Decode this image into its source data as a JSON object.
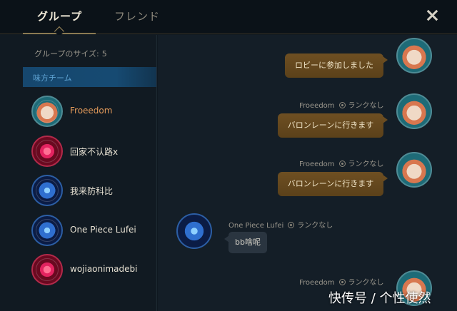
{
  "tabs": [
    {
      "label": "グループ",
      "active": true
    },
    {
      "label": "フレンド",
      "active": false
    }
  ],
  "group": {
    "size_label": "グループのサイズ:",
    "size_value": "5",
    "team_header": "味方チーム",
    "members": [
      {
        "name": "Froeedom",
        "avatar": "poro-icon",
        "is_self": true
      },
      {
        "name": "回家不认路x",
        "avatar": "heart-icon",
        "is_self": false
      },
      {
        "name": "我来防科比",
        "avatar": "blue-portrait-icon",
        "is_self": false
      },
      {
        "name": "One Piece Lufei",
        "avatar": "blue-portrait-icon",
        "is_self": false
      },
      {
        "name": "wojiaonimadebi",
        "avatar": "heart-icon",
        "is_self": false
      }
    ]
  },
  "chat": {
    "messages": [
      {
        "side": "out",
        "sender": "",
        "rank": "",
        "text": "ロビーに参加しました"
      },
      {
        "side": "out",
        "sender": "Froeedom",
        "rank": "ランクなし",
        "text": "バロンレーンに行きます"
      },
      {
        "side": "out",
        "sender": "Froeedom",
        "rank": "ランクなし",
        "text": "バロンレーンに行きます"
      },
      {
        "side": "in",
        "sender": "One Piece Lufei",
        "rank": "ランクなし",
        "text": "bb啥呢"
      },
      {
        "side": "out",
        "sender": "Froeedom",
        "rank": "ランクなし",
        "text": ""
      }
    ]
  },
  "watermark": "快传号 / 个性使然",
  "colors": {
    "accent_gold": "#8b7a52",
    "self_name": "#e39a5a",
    "team_header_bg": "#164a72",
    "bubble_out": "#6e4f22",
    "bubble_in": "#2a3540"
  }
}
